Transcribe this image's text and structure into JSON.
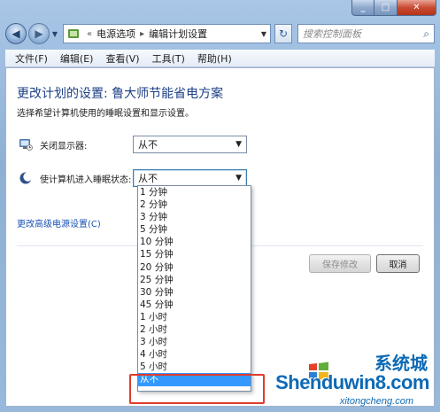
{
  "address": {
    "back_icon": "back-arrow-icon",
    "forward_icon": "forward-arrow-icon",
    "breadcrumb": [
      "电源选项",
      "编辑计划设置"
    ],
    "search_placeholder": "搜索控制面板"
  },
  "menubar": {
    "items": [
      "文件(F)",
      "编辑(E)",
      "查看(V)",
      "工具(T)",
      "帮助(H)"
    ]
  },
  "page": {
    "title": "更改计划的设置: 鲁大师节能省电方案",
    "subtitle": "选择希望计算机使用的睡眠设置和显示设置。",
    "display_off": {
      "label": "关闭显示器:",
      "value": "从不",
      "icon": "monitor-icon"
    },
    "sleep": {
      "label": "使计算机进入睡眠状态:",
      "value": "从不",
      "icon": "moon-sleep-icon"
    },
    "advanced_link": "更改高级电源设置(C)",
    "save_button": "保存修改",
    "cancel_button": "取消"
  },
  "dropdown": {
    "options": [
      "1 分钟",
      "2 分钟",
      "3 分钟",
      "5 分钟",
      "10 分钟",
      "15 分钟",
      "20 分钟",
      "25 分钟",
      "30 分钟",
      "45 分钟",
      "1 小时",
      "2 小时",
      "3 小时",
      "4 小时",
      "5 小时",
      "从不"
    ],
    "selected": "从不"
  },
  "watermark": {
    "brand_cn": "系统城",
    "brand": "Shenduwin8.com",
    "sub": "xitongcheng.com"
  },
  "colors": {
    "title_blue": "#1c3f85",
    "link_blue": "#1a52b3",
    "selection": "#3399ff",
    "highlight_red": "#e03b2c"
  }
}
